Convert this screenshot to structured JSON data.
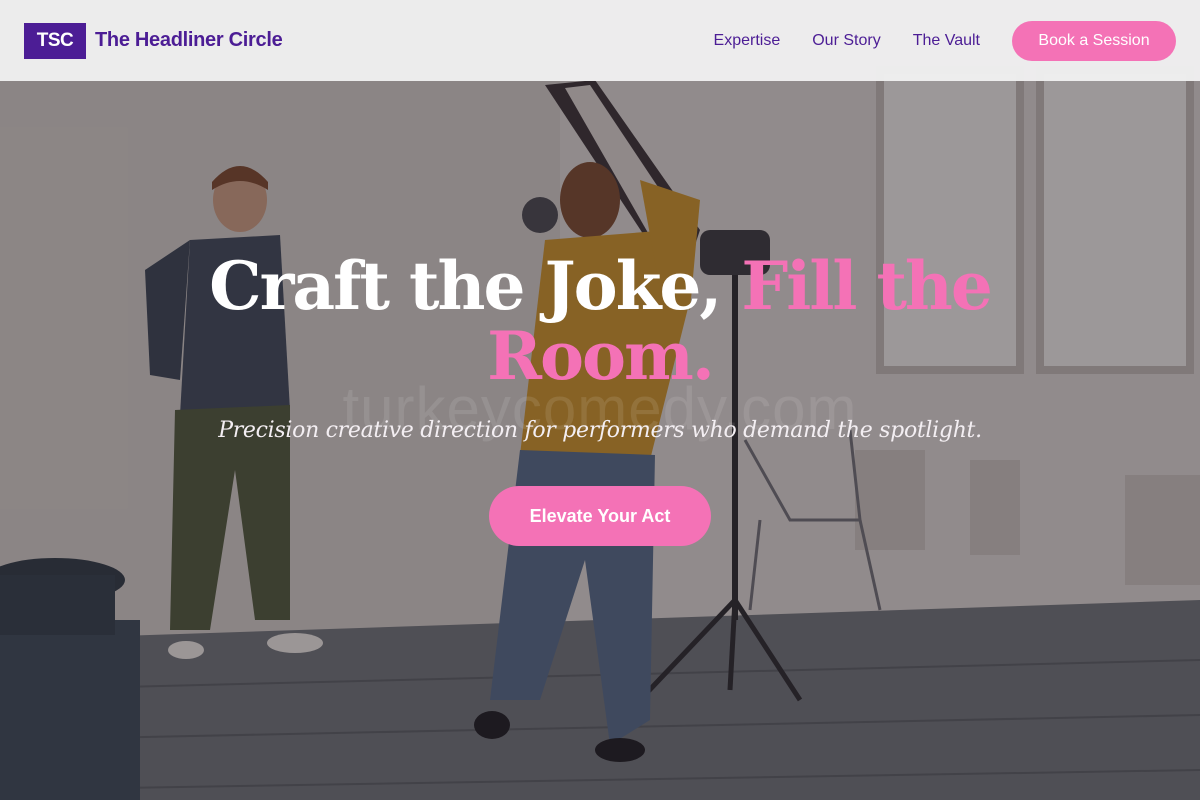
{
  "header": {
    "logo_badge": "TSC",
    "brand_name": "The Headliner Circle",
    "nav": [
      {
        "label": "Expertise"
      },
      {
        "label": "Our Story"
      },
      {
        "label": "The Vault"
      }
    ],
    "cta_label": "Book a Session"
  },
  "hero": {
    "title_part1": "Craft the Joke, ",
    "title_accent": "Fill the Room.",
    "subtitle": "Precision creative direction for performers who demand the spotlight.",
    "cta_label": "Elevate Your Act",
    "watermark": "turkeycomedy.com"
  },
  "colors": {
    "brand_purple": "#4c1d95",
    "accent_pink": "#f472b6",
    "header_bg": "#f0f0f0",
    "text_white": "#ffffff"
  }
}
